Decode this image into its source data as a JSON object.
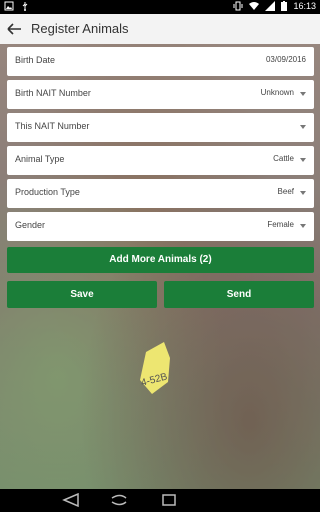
{
  "status_bar": {
    "time": "16:13",
    "left_icons": [
      "image-icon",
      "usb-icon"
    ],
    "right_icons": [
      "vibrate-icon",
      "wifi-icon",
      "signal-icon",
      "battery-icon"
    ]
  },
  "app_bar": {
    "title": "Register Animals",
    "back_icon": "arrow-back-icon"
  },
  "form": {
    "fields": [
      {
        "label": "Birth Date",
        "value": "03/09/2016",
        "dropdown": false
      },
      {
        "label": "Birth NAIT Number",
        "value": "Unknown",
        "dropdown": true
      },
      {
        "label": "This NAIT Number",
        "value": "",
        "dropdown": true
      },
      {
        "label": "Animal Type",
        "value": "Cattle",
        "dropdown": true
      },
      {
        "label": "Production Type",
        "value": "Beef",
        "dropdown": true
      },
      {
        "label": "Gender",
        "value": "Female",
        "dropdown": true
      }
    ]
  },
  "buttons": {
    "add_more": "Add More Animals (2)",
    "save": "Save",
    "send": "Send"
  },
  "background": {
    "tag_text": "4-52B"
  },
  "colors": {
    "accent": "#1b7e39",
    "app_bar": "#f3f3f3",
    "field_bg": "#ffffff"
  },
  "nav_bar": {
    "icons": [
      "nav-back-icon",
      "nav-home-icon",
      "nav-recents-icon"
    ]
  }
}
